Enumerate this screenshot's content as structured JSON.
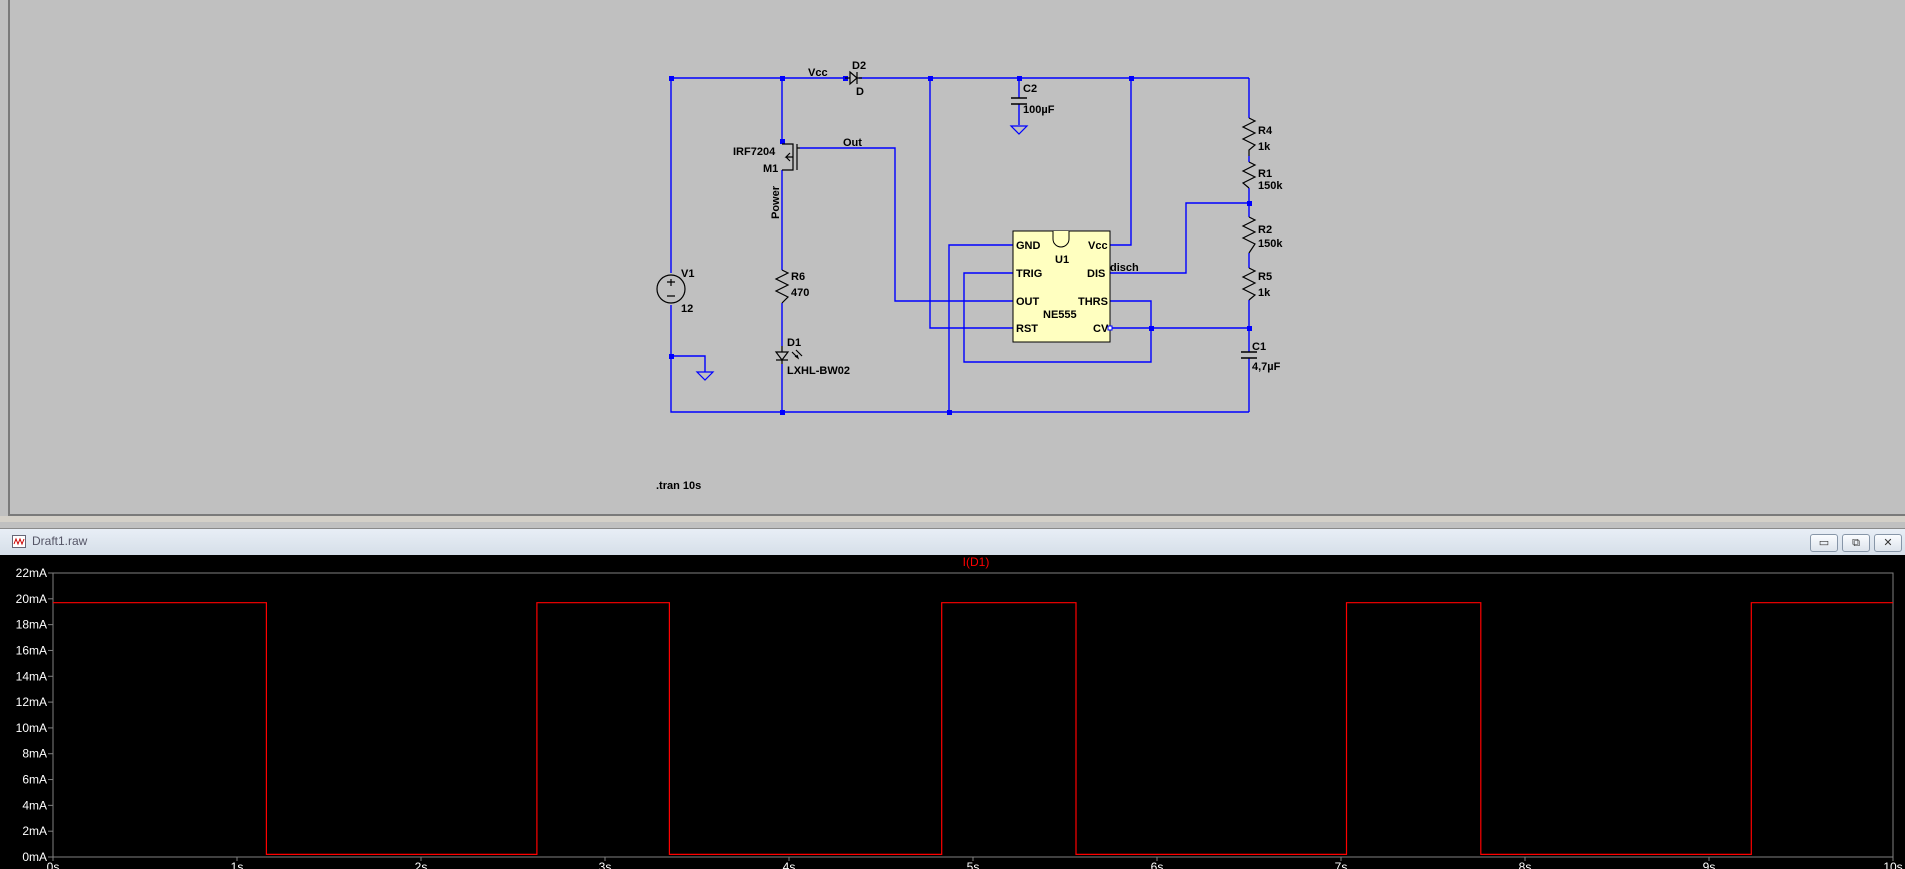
{
  "schematic": {
    "labels": {
      "vcc_net": "Vcc",
      "d2_ref": "D2",
      "d2_val": "D",
      "c2_ref": "C2",
      "c2_val": "100µF",
      "m1_model": "IRF7204",
      "m1_ref": "M1",
      "out_net": "Out",
      "power_net": "Power",
      "v1_ref": "V1",
      "v1_val": "12",
      "r6_ref": "R6",
      "r6_val": "470",
      "d1_ref": "D1",
      "d1_val": "LXHL-BW02",
      "r4_ref": "R4",
      "r4_val": "1k",
      "r1_ref": "R1",
      "r1_val": "150k",
      "r2_ref": "R2",
      "r2_val": "150k",
      "r5_ref": "R5",
      "r5_val": "1k",
      "c1_ref": "C1",
      "c1_val": "4,7µF",
      "disch_net": "disch",
      "u1_ref": "U1",
      "u1_part": "NE555",
      "pin_gnd": "GND",
      "pin_vcc": "Vcc",
      "pin_trig": "TRIG",
      "pin_dis": "DIS",
      "pin_out": "OUT",
      "pin_thrs": "THRS",
      "pin_rst": "RST",
      "pin_cv": "CV",
      "directive": ".tran 10s"
    },
    "colors": {
      "wire": "#0000ff",
      "ic_fill": "#ffffc0",
      "background": "#c0c0c0"
    }
  },
  "waveform_window": {
    "title": "Draft1.raw",
    "buttons": {
      "minimize": "▭",
      "restore": "⧉",
      "close": "✕"
    }
  },
  "chart_data": {
    "type": "line",
    "title": "I(D1)",
    "xlabel": "",
    "ylabel": "",
    "x_ticks": [
      "0s",
      "1s",
      "2s",
      "3s",
      "4s",
      "5s",
      "6s",
      "7s",
      "8s",
      "9s",
      "10s"
    ],
    "y_ticks": [
      "0mA",
      "2mA",
      "4mA",
      "6mA",
      "8mA",
      "10mA",
      "12mA",
      "14mA",
      "16mA",
      "18mA",
      "20mA",
      "22mA"
    ],
    "xlim": [
      0,
      10
    ],
    "ylim": [
      0,
      22
    ],
    "x_unit": "s",
    "y_unit": "mA",
    "series": [
      {
        "name": "I(D1)",
        "color": "#ff0000",
        "x": [
          0,
          1.16,
          1.16,
          2.63,
          2.63,
          3.35,
          3.35,
          4.83,
          4.83,
          5.56,
          5.56,
          7.03,
          7.03,
          7.76,
          7.76,
          9.23,
          9.23,
          10
        ],
        "y": [
          19.7,
          19.7,
          0.2,
          0.2,
          19.7,
          19.7,
          0.2,
          0.2,
          19.7,
          19.7,
          0.2,
          0.2,
          19.7,
          19.7,
          0.2,
          0.2,
          19.7,
          19.7
        ]
      }
    ],
    "grid": false,
    "colors": {
      "background": "#000000",
      "axis": "#808080",
      "tick_label": "#ffffff"
    }
  }
}
